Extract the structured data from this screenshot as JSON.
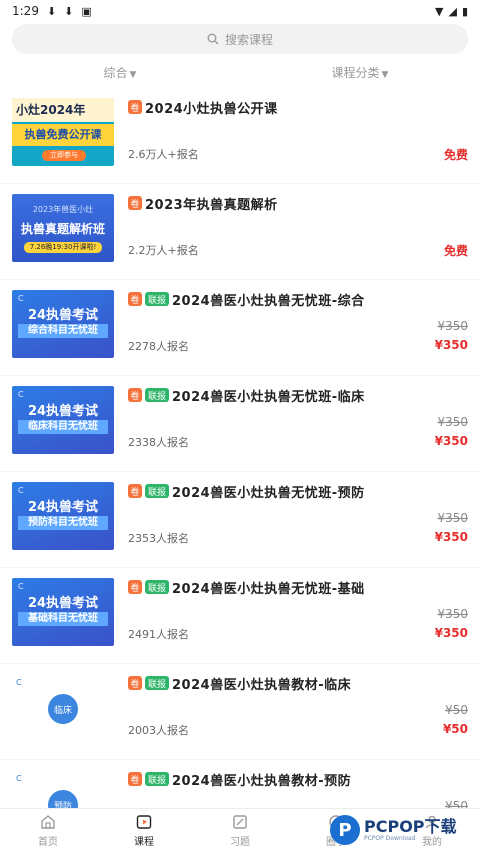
{
  "status": {
    "time": "1:29"
  },
  "search": {
    "placeholder": "搜索课程"
  },
  "filters": [
    {
      "label": "综合"
    },
    {
      "label": "课程分类"
    }
  ],
  "thumb_text": {
    "open_line1": "小灶2024年",
    "open_line2": "执兽免费公开课",
    "open_button": "立即参与",
    "exam_line1": "2023年兽医小灶",
    "exam_line2": "执兽真题解析班",
    "exam_line3": "7.26晚19:30开课啦!",
    "course_big": "24执兽考试",
    "course_sub_zonghe": "综合科目无忧班",
    "course_sub_linchuang": "临床科目无忧班",
    "course_sub_yufang": "预防科目无忧班",
    "course_sub_jichu": "基础科目无忧班",
    "book_circle_linchuang": "临床",
    "book_circle_yufang": "预防"
  },
  "courses": [
    {
      "title": "2024小灶执兽公开课",
      "tags": [
        "卷"
      ],
      "enrolled": "2.6万人+报名",
      "price": "免费",
      "old_price": ""
    },
    {
      "title": "2023年执兽真题解析",
      "tags": [
        "卷"
      ],
      "enrolled": "2.2万人+报名",
      "price": "免费",
      "old_price": ""
    },
    {
      "title": "2024兽医小灶执兽无忧班-综合",
      "tags": [
        "卷",
        "联报"
      ],
      "enrolled": "2278人报名",
      "price": "¥350",
      "old_price": "¥350"
    },
    {
      "title": "2024兽医小灶执兽无忧班-临床",
      "tags": [
        "卷",
        "联报"
      ],
      "enrolled": "2338人报名",
      "price": "¥350",
      "old_price": "¥350"
    },
    {
      "title": "2024兽医小灶执兽无忧班-预防",
      "tags": [
        "卷",
        "联报"
      ],
      "enrolled": "2353人报名",
      "price": "¥350",
      "old_price": "¥350"
    },
    {
      "title": "2024兽医小灶执兽无忧班-基础",
      "tags": [
        "卷",
        "联报"
      ],
      "enrolled": "2491人报名",
      "price": "¥350",
      "old_price": "¥350"
    },
    {
      "title": "2024兽医小灶执兽教材-临床",
      "tags": [
        "卷",
        "联报"
      ],
      "enrolled": "2003人报名",
      "price": "¥50",
      "old_price": "¥50"
    },
    {
      "title": "2024兽医小灶执兽教材-预防",
      "tags": [
        "卷",
        "联报"
      ],
      "enrolled": "",
      "price": "",
      "old_price": "¥50"
    }
  ],
  "tabs": [
    {
      "label": "首页",
      "icon": "home-icon"
    },
    {
      "label": "课程",
      "icon": "course-icon",
      "active": true
    },
    {
      "label": "习题",
      "icon": "exercise-icon"
    },
    {
      "label": "圈子",
      "icon": "circle-icon"
    },
    {
      "label": "我的",
      "icon": "profile-icon"
    }
  ],
  "watermark": {
    "logo": "P",
    "name": "PCPOP下载",
    "sub": "PCPOP Download"
  },
  "colors": {
    "price_red": "#e62e2e",
    "tag_orange": "#f4733c",
    "tag_green": "#2fb56a"
  }
}
